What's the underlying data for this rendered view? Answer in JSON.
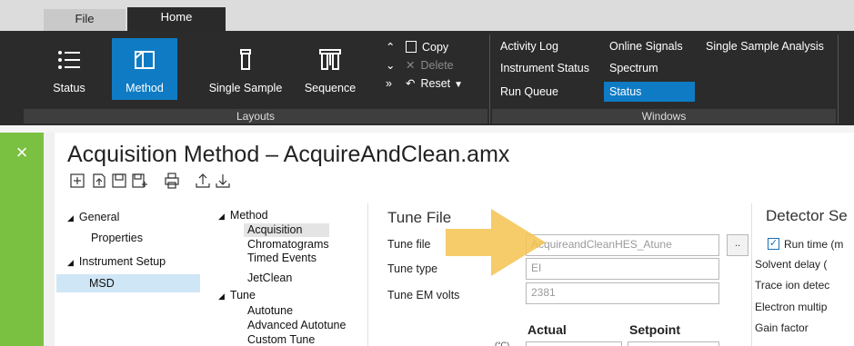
{
  "tabs": {
    "file": "File",
    "home": "Home"
  },
  "ribbon": {
    "status": "Status",
    "method": "Method",
    "single_sample": "Single Sample",
    "sequence": "Sequence",
    "copy": "Copy",
    "delete": "Delete",
    "reset": "Reset",
    "layouts_group": "Layouts",
    "windows_group": "Windows",
    "windows": {
      "activity_log": "Activity Log",
      "online_signals": "Online Signals",
      "single_sample_analysis": "Single Sample Analysis",
      "instrument_status": "Instrument Status",
      "spectrum": "Spectrum",
      "run_queue": "Run Queue",
      "status": "Status"
    }
  },
  "page": {
    "title": "Acquisition Method – AcquireAndClean.amx",
    "close": "×"
  },
  "left_tree": {
    "general": "General",
    "properties": "Properties",
    "instrument_setup": "Instrument Setup",
    "msd": "MSD"
  },
  "mid_tree": {
    "method": "Method",
    "acquisition": "Acquisition",
    "chromatograms": "Chromatograms",
    "timed_events": "Timed Events",
    "jetclean": "JetClean",
    "tune": "Tune",
    "autotune": "Autotune",
    "advanced_autotune": "Advanced Autotune",
    "custom_tune": "Custom Tune"
  },
  "tune_file": {
    "section": "Tune File",
    "tune_file_label": "Tune file",
    "tune_file_value": "AcquireandCleanHES_Atune",
    "browse": "..",
    "tune_type_label": "Tune type",
    "tune_type_value": "EI",
    "tune_em_label": "Tune EM volts",
    "tune_em_value": "2381",
    "actual": "Actual",
    "setpoint": "Setpoint",
    "partial": "(°C)"
  },
  "detector": {
    "section": "Detector Se",
    "run_time": "Run time (m",
    "solvent_delay": "Solvent delay (",
    "trace_ion": "Trace ion detec",
    "electron_mult": "Electron multip",
    "gain_factor": "Gain factor"
  },
  "colors": {
    "accent": "#0f7bc4",
    "green": "#7ac142",
    "arrow": "#f5c24f"
  }
}
